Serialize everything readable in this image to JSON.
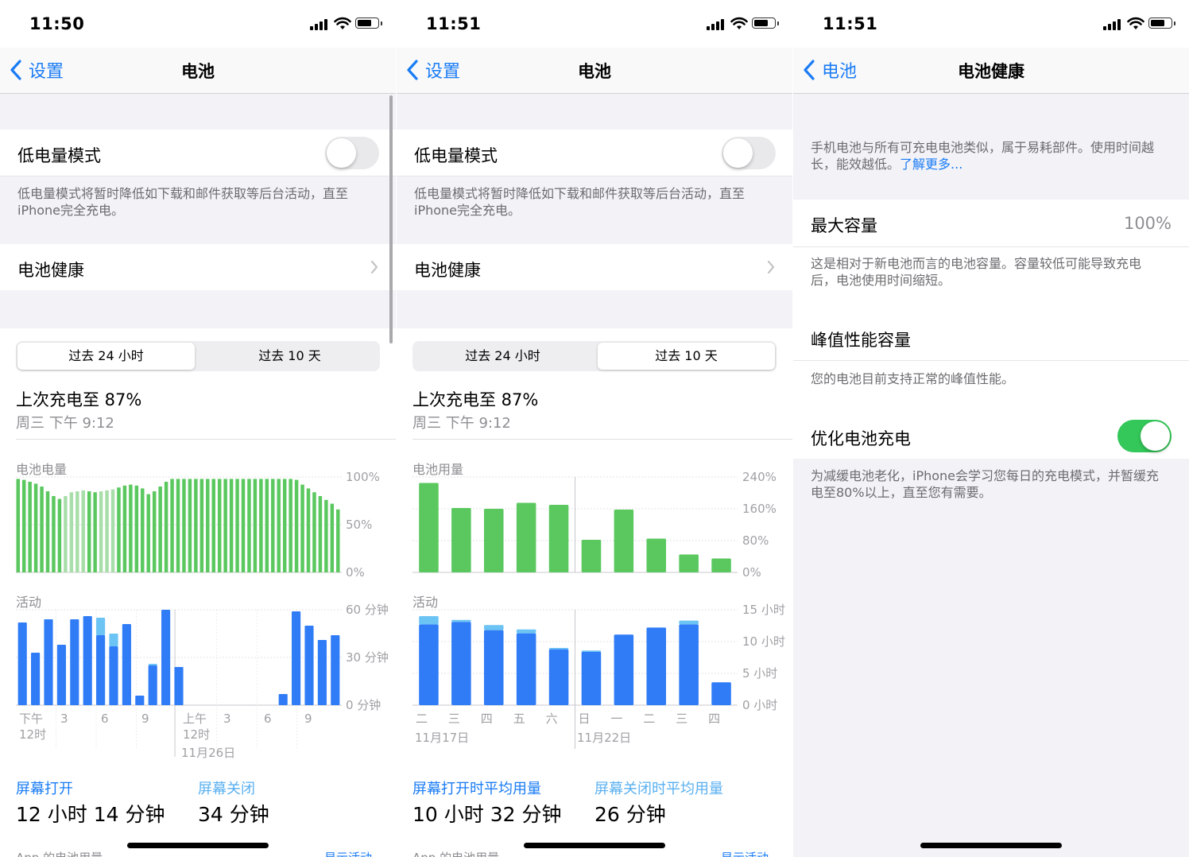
{
  "panels": [
    {
      "time": "11:50",
      "back_label": "设置",
      "title": "电池",
      "low_power_label": "低电量模式",
      "low_power_desc": "低电量模式将暂时降低如下载和邮件获取等后台活动，直至iPhone完全充电。",
      "battery_health_label": "电池健康",
      "segments": [
        "过去 24 小时",
        "过去 10 天"
      ],
      "selected_segment": 0,
      "last_charge": "上次充电至 87%",
      "last_charge_time": "周三 下午 9:12",
      "chart1_title": "电池电量",
      "chart1_yticks": [
        "100%",
        "50%",
        "0%"
      ],
      "chart2_title": "活动",
      "chart2_yticks": [
        "60 分钟",
        "30 分钟",
        "0 分钟"
      ],
      "xticks": [
        "下午",
        "3",
        "6",
        "9",
        "上午",
        "3",
        "6",
        "9"
      ],
      "xticks_line2": [
        "12时",
        "",
        "",
        "",
        "12时",
        "",
        "",
        ""
      ],
      "date_label": "11月26日",
      "stat1_label": "屏幕打开",
      "stat1_value": "12 小时 14 分钟",
      "stat2_label": "屏幕关闭",
      "stat2_value": "34 分钟",
      "footer_left": "App 的电池用量",
      "footer_right": "显示活动"
    },
    {
      "time": "11:51",
      "back_label": "设置",
      "title": "电池",
      "low_power_label": "低电量模式",
      "low_power_desc": "低电量模式将暂时降低如下载和邮件获取等后台活动，直至iPhone完全充电。",
      "battery_health_label": "电池健康",
      "segments": [
        "过去 24 小时",
        "过去 10 天"
      ],
      "selected_segment": 1,
      "last_charge": "上次充电至 87%",
      "last_charge_time": "周三 下午 9:12",
      "chart1_title": "电池用量",
      "chart1_yticks": [
        "240%",
        "160%",
        "80%",
        "0%"
      ],
      "chart2_title": "活动",
      "chart2_yticks": [
        "15 小时",
        "10 小时",
        "5 小时",
        "0 小时"
      ],
      "xticks": [
        "二",
        "三",
        "四",
        "五",
        "六",
        "日",
        "一",
        "二",
        "三",
        "四"
      ],
      "date_labels": [
        "11月17日",
        "11月22日"
      ],
      "stat1_label": "屏幕打开时平均用量",
      "stat1_value": "10 小时 32 分钟",
      "stat2_label": "屏幕关闭时平均用量",
      "stat2_value": "26 分钟",
      "footer_left": "App 的电池用量",
      "footer_right": "显示活动"
    },
    {
      "time": "11:51",
      "back_label": "电池",
      "title": "电池健康",
      "intro": "手机电池与所有可充电电池类似，属于易耗部件。使用时间越长，能效越低。",
      "intro_link": "了解更多...",
      "max_capacity_label": "最大容量",
      "max_capacity_value": "100%",
      "max_capacity_desc": "这是相对于新电池而言的电池容量。容量较低可能导致充电后，电池使用时间缩短。",
      "peak_label": "峰值性能容量",
      "peak_desc": "您的电池目前支持正常的峰值性能。",
      "optimize_label": "优化电池充电",
      "optimize_on": true,
      "optimize_desc": "为减缓电池老化，iPhone会学习您每日的充电模式，并暂缓充电至80%以上，直至您有需要。"
    }
  ],
  "colors": {
    "accent": "#1a7cf5",
    "green": "#5ac85f",
    "blue_bar": "#2f7cf6",
    "light_blue_bar": "#6cc4f4",
    "toggle_on": "#34c759"
  },
  "chart_data": [
    {
      "type": "area",
      "title": "电池电量",
      "ylim": [
        0,
        100
      ],
      "y_unit": "%",
      "x_ticks": [
        "下午 12时",
        "3",
        "6",
        "9",
        "上午 12时",
        "3",
        "6",
        "9"
      ],
      "values": [
        98,
        97,
        95,
        93,
        90,
        85,
        80,
        77,
        80,
        84,
        85,
        86,
        85,
        84,
        85,
        86,
        87,
        89,
        91,
        92,
        91,
        88,
        82,
        85,
        90,
        95,
        98,
        98,
        98,
        98,
        98,
        98,
        98,
        98,
        98,
        98,
        98,
        98,
        98,
        98,
        98,
        98,
        98,
        98,
        98,
        98,
        98,
        97,
        92,
        88,
        84,
        80,
        76,
        72,
        66
      ]
    },
    {
      "type": "bar",
      "title": "活动",
      "ylim": [
        0,
        60
      ],
      "y_unit": "分钟",
      "x_ticks": [
        "下午 12时",
        "3",
        "6",
        "9",
        "上午 12时",
        "3",
        "6",
        "9"
      ],
      "series": [
        {
          "name": "屏幕打开",
          "values": [
            52,
            33,
            54,
            38,
            54,
            56,
            44,
            37,
            51,
            6,
            25,
            60,
            24,
            0,
            0,
            0,
            0,
            0,
            0,
            0,
            7,
            59,
            50,
            41,
            44
          ]
        },
        {
          "name": "屏幕关闭",
          "values": [
            0,
            0,
            0,
            0,
            0,
            0,
            11,
            8,
            0,
            0,
            1,
            0,
            0,
            0,
            0,
            0,
            0,
            0,
            0,
            0,
            0,
            0,
            0,
            0,
            0
          ]
        }
      ]
    },
    {
      "type": "bar",
      "title": "电池用量",
      "ylim": [
        0,
        240
      ],
      "y_unit": "%",
      "categories": [
        "二",
        "三",
        "四",
        "五",
        "六",
        "日",
        "一",
        "二",
        "三",
        "四"
      ],
      "values": [
        225,
        162,
        160,
        175,
        170,
        82,
        158,
        85,
        45,
        35
      ]
    },
    {
      "type": "bar",
      "title": "活动",
      "ylim": [
        0,
        15
      ],
      "y_unit": "小时",
      "categories": [
        "二",
        "三",
        "四",
        "五",
        "六",
        "日",
        "一",
        "二",
        "三",
        "四"
      ],
      "series": [
        {
          "name": "屏幕打开时平均用量",
          "values": [
            12.7,
            13.1,
            11.8,
            11.3,
            8.8,
            8.4,
            11.1,
            12.2,
            12.7,
            3.6
          ]
        },
        {
          "name": "屏幕关闭时平均用量",
          "values": [
            1.3,
            0.3,
            0.8,
            0.6,
            0.2,
            0.2,
            0.0,
            0.0,
            0.6,
            0.0
          ]
        }
      ]
    }
  ]
}
